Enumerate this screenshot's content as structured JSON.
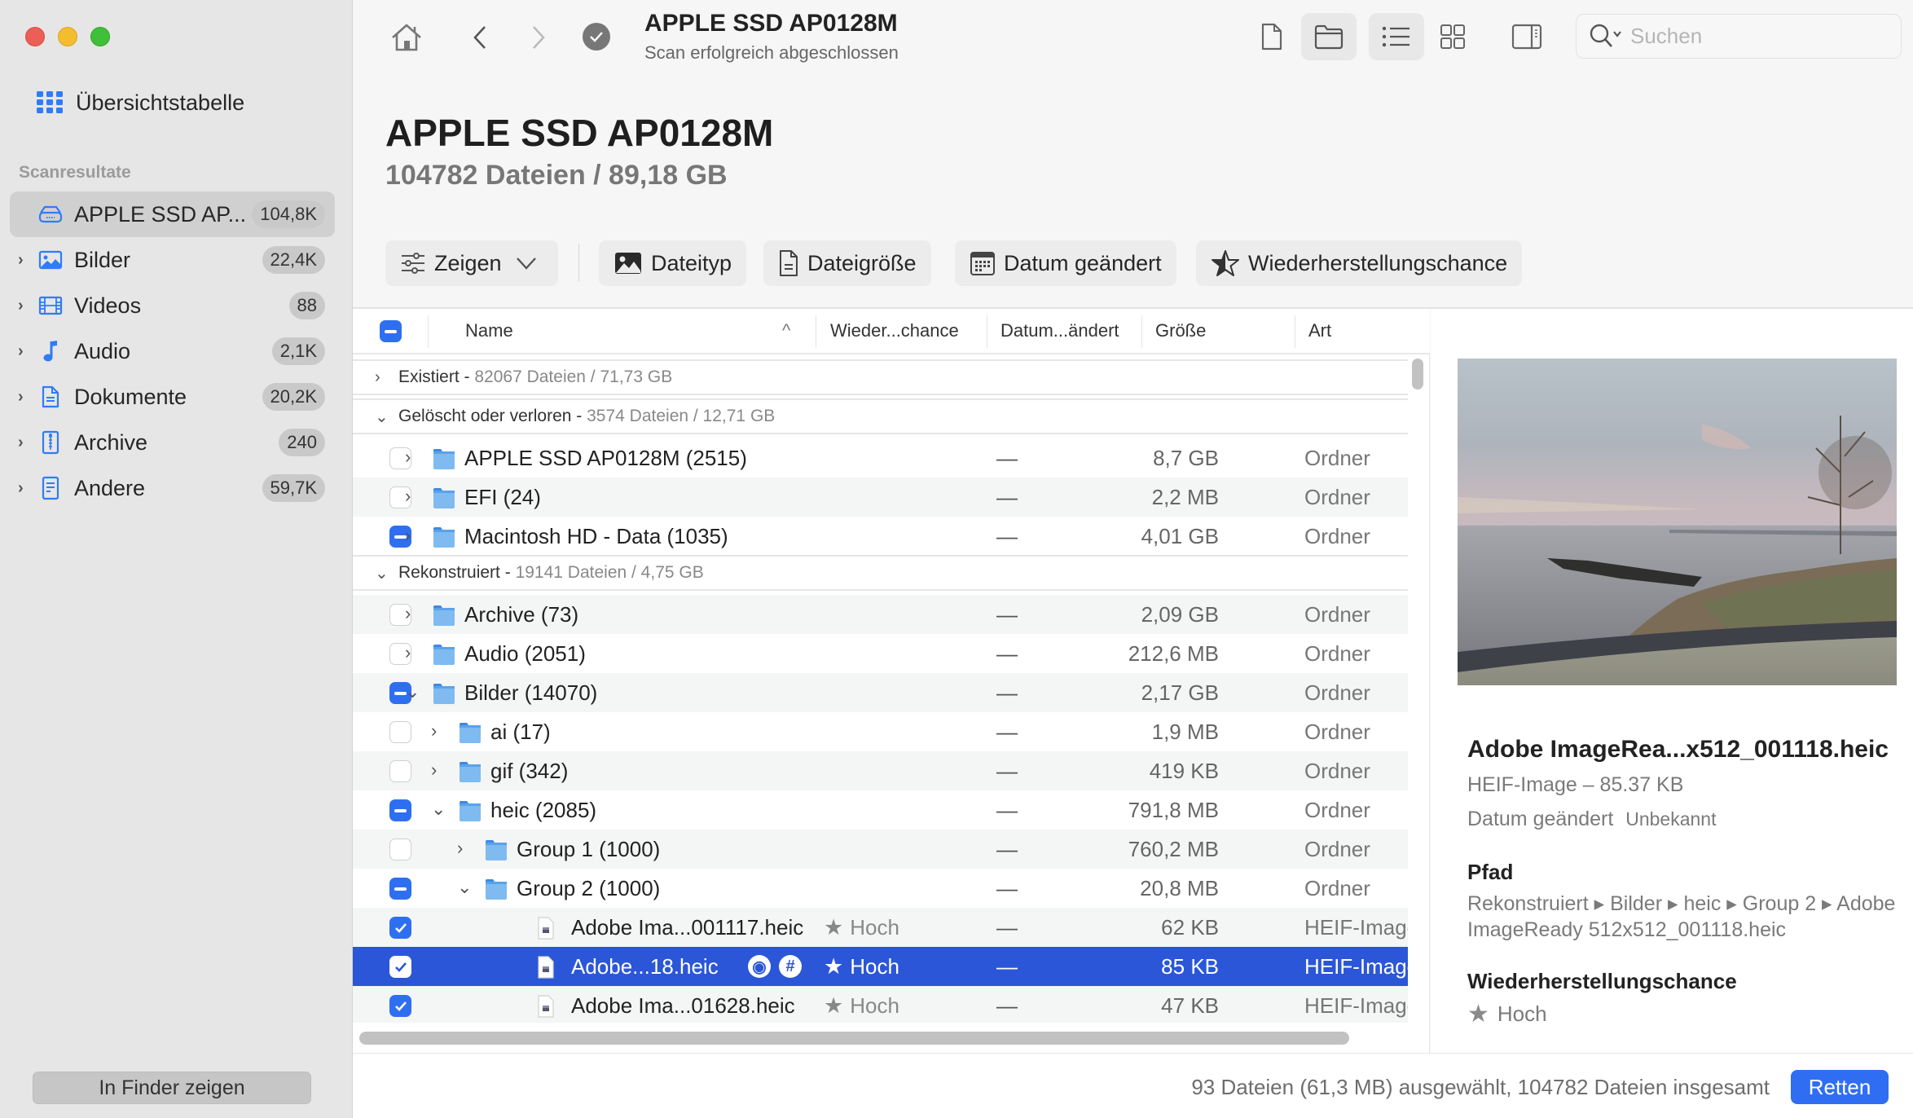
{
  "window": {
    "controls": [
      "close",
      "minimize",
      "zoom"
    ]
  },
  "sidebar": {
    "overview_label": "Übersichtstabelle",
    "section_label": "Scanresultate",
    "items": [
      {
        "label": "APPLE SSD AP...",
        "count": "104,8K",
        "icon": "drive-icon",
        "active": true
      },
      {
        "label": "Bilder",
        "count": "22,4K",
        "icon": "image-icon"
      },
      {
        "label": "Videos",
        "count": "88",
        "icon": "film-icon"
      },
      {
        "label": "Audio",
        "count": "2,1K",
        "icon": "music-note-icon"
      },
      {
        "label": "Dokumente",
        "count": "20,2K",
        "icon": "document-icon"
      },
      {
        "label": "Archive",
        "count": "240",
        "icon": "zip-archive-icon"
      },
      {
        "label": "Andere",
        "count": "59,7K",
        "icon": "other-file-icon"
      }
    ],
    "finder_button": "In Finder zeigen"
  },
  "topbar": {
    "title": "APPLE SSD AP0128M",
    "subtitle": "Scan erfolgreich abgeschlossen",
    "search_placeholder": "Suchen"
  },
  "header": {
    "title": "APPLE SSD AP0128M",
    "summary": "104782 Dateien / 89,18 GB"
  },
  "filters": {
    "show": "Zeigen",
    "file_type": "Dateityp",
    "file_size": "Dateigröße",
    "date_modified": "Datum geändert",
    "recovery_chance": "Wiederherstellungschance"
  },
  "table": {
    "columns": {
      "name": "Name",
      "recovery": "Wieder...chance",
      "date": "Datum...ändert",
      "size": "Größe",
      "kind": "Art"
    },
    "groups": [
      {
        "label": "Existiert",
        "meta": "82067 Dateien / 71,73 GB",
        "expanded": false
      },
      {
        "label": "Gelöscht oder verloren",
        "meta": "3574 Dateien / 12,71 GB",
        "expanded": true
      },
      {
        "label": "Rekonstruiert",
        "meta": "19141 Dateien / 4,75 GB",
        "expanded": true
      }
    ],
    "rows": [
      {
        "name": "APPLE SSD AP0128M (2515)",
        "rec": "",
        "date": "—",
        "size": "8,7 GB",
        "kind": "Ordner",
        "check": "none",
        "level": 0,
        "expanded": false,
        "type": "folder"
      },
      {
        "name": "EFI (24)",
        "rec": "",
        "date": "—",
        "size": "2,2 MB",
        "kind": "Ordner",
        "check": "none",
        "level": 0,
        "expanded": false,
        "type": "folder"
      },
      {
        "name": "Macintosh HD - Data (1035)",
        "rec": "",
        "date": "—",
        "size": "4,01 GB",
        "kind": "Ordner",
        "check": "mixed",
        "level": 0,
        "expanded": false,
        "type": "folder"
      },
      {
        "name": "Archive (73)",
        "rec": "",
        "date": "—",
        "size": "2,09 GB",
        "kind": "Ordner",
        "check": "none",
        "level": 0,
        "expanded": false,
        "type": "folder"
      },
      {
        "name": "Audio (2051)",
        "rec": "",
        "date": "—",
        "size": "212,6 MB",
        "kind": "Ordner",
        "check": "none",
        "level": 0,
        "expanded": false,
        "type": "folder"
      },
      {
        "name": "Bilder (14070)",
        "rec": "",
        "date": "—",
        "size": "2,17 GB",
        "kind": "Ordner",
        "check": "mixed",
        "level": 0,
        "expanded": true,
        "type": "folder"
      },
      {
        "name": "ai (17)",
        "rec": "",
        "date": "—",
        "size": "1,9 MB",
        "kind": "Ordner",
        "check": "none",
        "level": 1,
        "expanded": false,
        "type": "folder"
      },
      {
        "name": "gif (342)",
        "rec": "",
        "date": "—",
        "size": "419 KB",
        "kind": "Ordner",
        "check": "none",
        "level": 1,
        "expanded": false,
        "type": "folder"
      },
      {
        "name": "heic (2085)",
        "rec": "",
        "date": "—",
        "size": "791,8 MB",
        "kind": "Ordner",
        "check": "mixed",
        "level": 1,
        "expanded": true,
        "type": "folder"
      },
      {
        "name": "Group 1 (1000)",
        "rec": "",
        "date": "—",
        "size": "760,2 MB",
        "kind": "Ordner",
        "check": "none",
        "level": 2,
        "expanded": false,
        "type": "folder"
      },
      {
        "name": "Group 2 (1000)",
        "rec": "",
        "date": "—",
        "size": "20,8 MB",
        "kind": "Ordner",
        "check": "mixed",
        "level": 2,
        "expanded": true,
        "type": "folder"
      },
      {
        "name": "Adobe Ima...001117.heic",
        "rec": "Hoch",
        "date": "—",
        "size": "62 KB",
        "kind": "HEIF-Image",
        "check": "checked",
        "level": 3,
        "type": "file"
      },
      {
        "name": "Adobe...18.heic",
        "rec": "Hoch",
        "date": "—",
        "size": "85 KB",
        "kind": "HEIF-Image",
        "check": "checked",
        "level": 3,
        "type": "file",
        "selected": true
      },
      {
        "name": "Adobe Ima...01628.heic",
        "rec": "Hoch",
        "date": "—",
        "size": "47 KB",
        "kind": "HEIF-Image",
        "check": "checked",
        "level": 3,
        "type": "file"
      }
    ]
  },
  "detail": {
    "filename": "Adobe ImageRea...x512_001118.heic",
    "type_size": "HEIF-Image – 85.37 KB",
    "date_label": "Datum geändert",
    "date_value": "Unbekannt",
    "path_label": "Pfad",
    "path": "Rekonstruiert ▸ Bilder ▸ heic ▸ Group 2 ▸ Adobe ImageReady 512x512_001118.heic",
    "recovery_label": "Wiederherstellungschance",
    "recovery_value": "Hoch"
  },
  "footer": {
    "status": "93 Dateien (61,3 MB) ausgewählt, 104782 Dateien insgesamt",
    "recover_button": "Retten"
  },
  "colors": {
    "accent": "#2f6ef3",
    "selection": "#2b56d7"
  }
}
